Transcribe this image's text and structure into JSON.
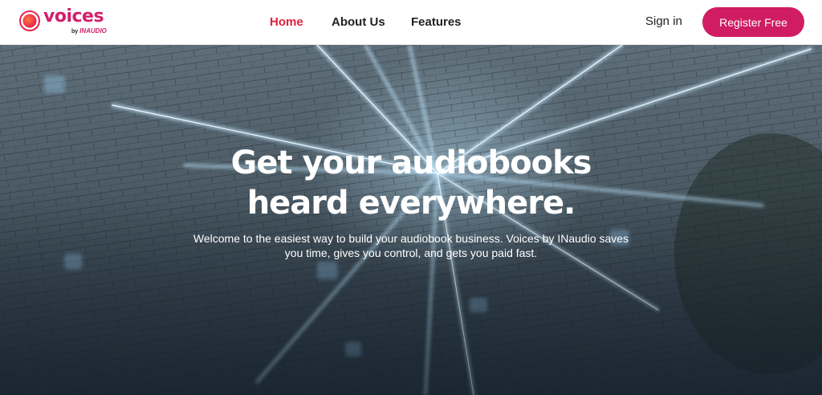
{
  "brand": {
    "name": "voices",
    "by_prefix": "by",
    "by_brand": "INAUDIO",
    "accent_color": "#d01c62"
  },
  "nav": {
    "items": [
      {
        "label": "Home",
        "active": true
      },
      {
        "label": "About Us",
        "active": false
      },
      {
        "label": "Features",
        "active": false
      }
    ],
    "active_color": "#e0213d"
  },
  "auth": {
    "sign_in_label": "Sign in",
    "register_label": "Register Free"
  },
  "hero": {
    "headline_line1": "Get your audiobooks",
    "headline_line2": "heard everywhere.",
    "subtext": "Welcome to the easiest way to build your audiobook business. Voices by INaudio saves you time, gives you control, and gets you paid fast."
  },
  "icons": [
    "voices-logo-icon"
  ]
}
